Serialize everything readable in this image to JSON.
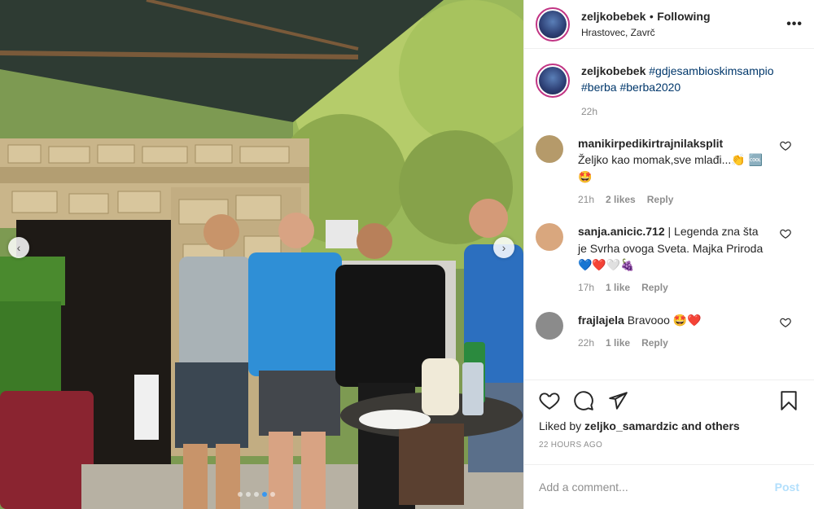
{
  "photo": {
    "alt": "",
    "carousel_total": 5,
    "carousel_active": 4
  },
  "header": {
    "username": "zeljkobebek",
    "separator": "•",
    "follow_label": "Following",
    "location": "Hrastovec, Zavrč",
    "more_icon": "more-horizontal-icon"
  },
  "caption": {
    "username": "zeljkobebek",
    "tags": [
      "#gdjesambioskimsampio",
      "#berba",
      "#berba2020"
    ],
    "time": "22h"
  },
  "comments": [
    {
      "username": "manikirpedikirtrajnilaksplit",
      "text": "Željko kao momak,sve mlađi...👏 🆒🤩",
      "time": "21h",
      "likes": "2 likes",
      "reply": "Reply",
      "avatar_color": "#b59a6a"
    },
    {
      "username": "sanja.anicic.712",
      "text": "| Legenda zna šta je Svrha ovoga Sveta. Majka Priroda💙❤️🤍🍇",
      "time": "17h",
      "likes": "1 like",
      "reply": "Reply",
      "avatar_color": "#d9a77e"
    },
    {
      "username": "frajlajela",
      "text": "Bravooo 🤩❤️",
      "time": "22h",
      "likes": "1 like",
      "reply": "Reply",
      "avatar_color": "#8b8b8b"
    }
  ],
  "actions": {
    "like_icon": "heart-icon",
    "comment_icon": "comment-icon",
    "share_icon": "share-icon",
    "save_icon": "bookmark-icon",
    "liked_by_prefix": "Liked by ",
    "liked_by_user": "zeljko_samardzic",
    "liked_by_suffix": " and others",
    "post_time": "22 HOURS AGO"
  },
  "add_comment": {
    "placeholder": "Add a comment...",
    "post_label": "Post"
  }
}
